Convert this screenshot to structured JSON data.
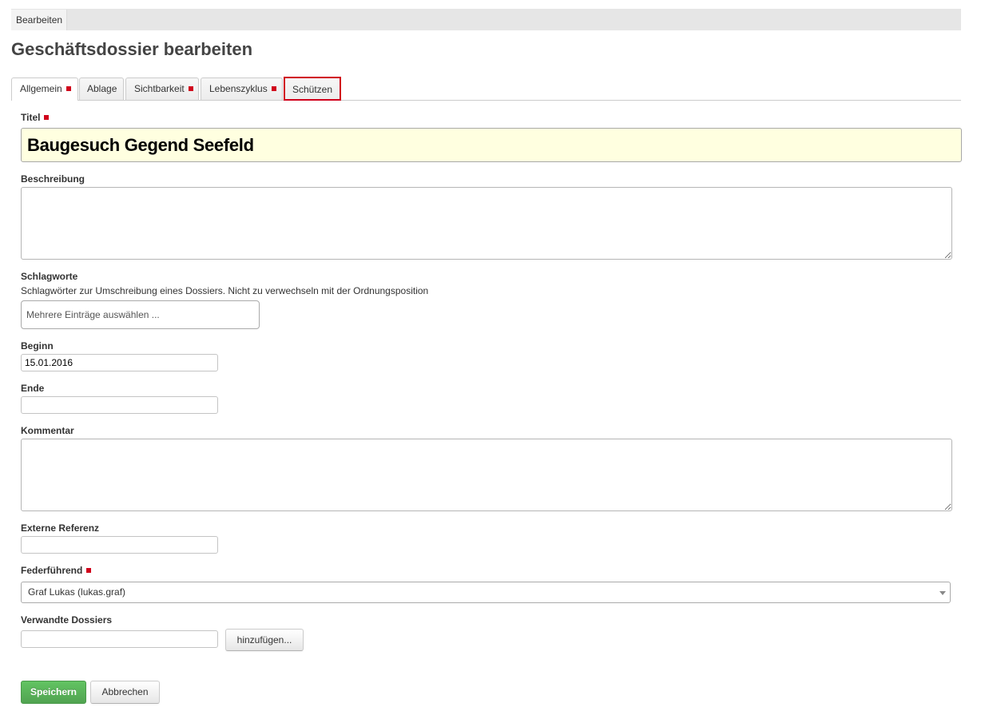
{
  "header": {
    "tab_label": "Bearbeiten"
  },
  "page_title": "Geschäftsdossier bearbeiten",
  "tabs": [
    {
      "label": "Allgemein",
      "required": true,
      "active": true
    },
    {
      "label": "Ablage",
      "required": false,
      "active": false
    },
    {
      "label": "Sichtbarkeit",
      "required": true,
      "active": false
    },
    {
      "label": "Lebenszyklus",
      "required": true,
      "active": false
    },
    {
      "label": "Schützen",
      "required": false,
      "active": false,
      "highlighted": true
    }
  ],
  "form": {
    "title": {
      "label": "Titel",
      "required": true,
      "value": "Baugesuch Gegend Seefeld"
    },
    "description": {
      "label": "Beschreibung",
      "value": ""
    },
    "keywords": {
      "label": "Schlagworte",
      "help": "Schlagwörter zur Umschreibung eines Dossiers. Nicht zu verwechseln mit der Ordnungsposition",
      "placeholder": "Mehrere Einträge auswählen ..."
    },
    "start": {
      "label": "Beginn",
      "value": "15.01.2016"
    },
    "end": {
      "label": "Ende",
      "value": ""
    },
    "comment": {
      "label": "Kommentar",
      "value": ""
    },
    "external_reference": {
      "label": "Externe Referenz",
      "value": ""
    },
    "responsible": {
      "label": "Federführend",
      "required": true,
      "selected": "Graf Lukas (lukas.graf)"
    },
    "related_dossiers": {
      "label": "Verwandte Dossiers",
      "value": "",
      "add_button": "hinzufügen..."
    }
  },
  "actions": {
    "save": "Speichern",
    "cancel": "Abbrechen"
  },
  "icons": {
    "required_marker": "required-marker-icon",
    "dropdown": "caret-down-icon"
  },
  "colors": {
    "required_marker": "#d0021b",
    "highlight_border": "#d0021b",
    "save_button": "#5cb85c",
    "title_input_background": "#ffffe0"
  }
}
